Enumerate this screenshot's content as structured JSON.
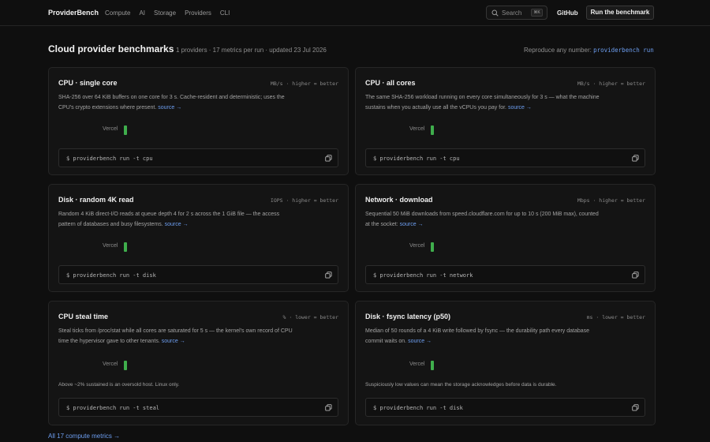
{
  "nav": {
    "brand": "ProviderBench",
    "links": [
      "Compute",
      "AI",
      "Storage",
      "Providers",
      "CLI"
    ],
    "search_placeholder": "Search",
    "search_kbd": "⌘K",
    "github": "GitHub",
    "cta": "Run the benchmark"
  },
  "header": {
    "title": "Cloud provider benchmarks",
    "meta": "1 providers · 17 metrics per run · updated 23 Jul 2026",
    "repro_label": "Reproduce any number:",
    "repro_cmd": "providerbench run"
  },
  "cards": [
    {
      "title": "CPU · single core",
      "unit": "MB/s · higher = better",
      "desc": "SHA-256 over 64 KiB buffers on one core for 3 s. Cache-resident and deterministic; uses the CPU's crypto extensions where present.",
      "source": "source →",
      "provider": "Vercel",
      "note": "",
      "cmd": "$ providerbench run -t cpu"
    },
    {
      "title": "CPU · all cores",
      "unit": "MB/s · higher = better",
      "desc": "The same SHA-256 workload running on every core simultaneously for 3 s — what the machine sustains when you actually use all the vCPUs you pay for.",
      "source": "source →",
      "provider": "Vercel",
      "note": "",
      "cmd": "$ providerbench run -t cpu"
    },
    {
      "title": "Disk · random 4K read",
      "unit": "IOPS · higher = better",
      "desc": "Random 4 KiB direct-I/O reads at queue depth 4 for 2 s across the 1 GiB file — the access pattern of databases and busy filesystems.",
      "source": "source →",
      "provider": "Vercel",
      "note": "",
      "cmd": "$ providerbench run -t disk"
    },
    {
      "title": "Network · download",
      "unit": "Mbps · higher = better",
      "desc": "Sequential 50 MiB downloads from speed.cloudflare.com for up to 10 s (200 MiB max), counted at the socket:",
      "source": "source →",
      "provider": "Vercel",
      "note": "",
      "cmd": "$ providerbench run -t network"
    },
    {
      "title": "CPU steal time",
      "unit": "% · lower = better",
      "desc": "Steal ticks from /proc/stat while all cores are saturated for 5 s — the kernel's own record of CPU time the hypervisor gave to other tenants.",
      "source": "source →",
      "provider": "Vercel",
      "note": "Above ~2% sustained is an oversold host. Linux only.",
      "cmd": "$ providerbench run -t steal"
    },
    {
      "title": "Disk · fsync latency (p50)",
      "unit": "ms · lower = better",
      "desc": "Median of 50 rounds of a 4 KiB write followed by fsync — the durability path every database commit waits on.",
      "source": "source →",
      "provider": "Vercel",
      "note": "Suspiciously low values can mean the storage acknowledges before data is durable.",
      "cmd": "$ providerbench run -t disk"
    }
  ],
  "footer": {
    "link": "All 17 compute metrics →"
  },
  "colors": {
    "accent_link": "#6d9ef0",
    "bar": "#3fae4c"
  }
}
